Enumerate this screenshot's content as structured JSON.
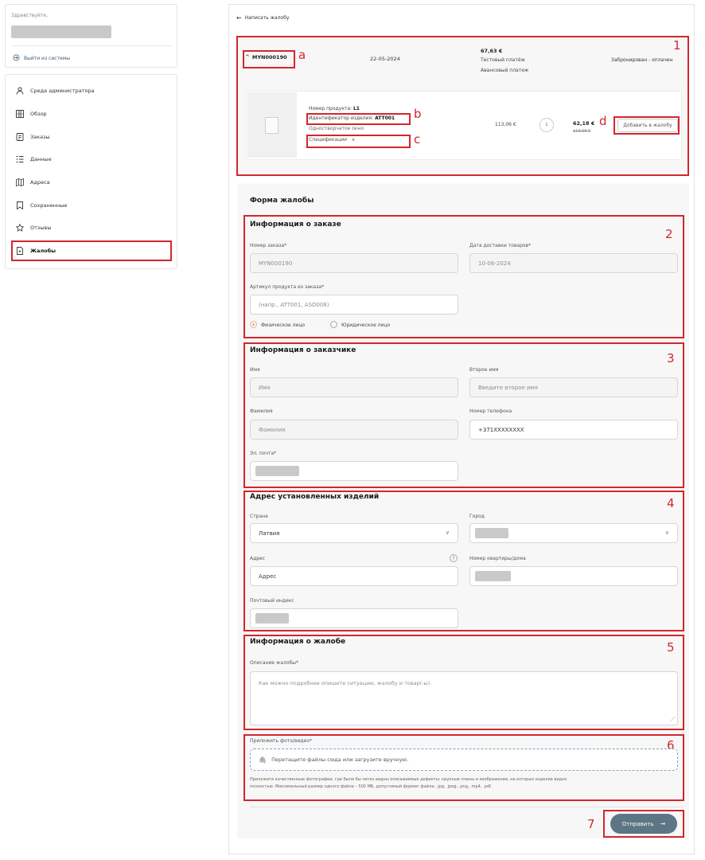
{
  "sidebar": {
    "greeting": "Здравствуйте,",
    "logout": "Выйти из системы",
    "items": [
      {
        "label": "Среда администратора",
        "icon": "user-icon"
      },
      {
        "label": "Обзор",
        "icon": "grid-icon"
      },
      {
        "label": "Заказы",
        "icon": "receipt-icon"
      },
      {
        "label": "Данные",
        "icon": "list-icon"
      },
      {
        "label": "Адреса",
        "icon": "map-icon"
      },
      {
        "label": "Сохраненные",
        "icon": "bookmark-icon"
      },
      {
        "label": "Отзывы",
        "icon": "star-icon"
      },
      {
        "label": "Жалобы",
        "icon": "document-icon",
        "active": true
      }
    ]
  },
  "header": {
    "back_label": "Написать жалобу"
  },
  "order": {
    "number": "MYN000190",
    "date": "22-05-2024",
    "total": "67,63 €",
    "payment_type": "Тестовый платёж",
    "payment_kind": "Авансовый платеж",
    "status": "Забронирован - оплачен"
  },
  "product": {
    "number_label": "Номер продукта:",
    "number_value": "L1",
    "id_label": "Идентификатор изделия:",
    "id_value": "ATT001",
    "name": "Одностворчатое окно",
    "specs_label": "Спецификации",
    "unit_price": "113,06 €",
    "quantity": "1",
    "price": "62,18 €",
    "old_price": "113,06 €",
    "add_button": "Добавить в жалобу"
  },
  "form": {
    "title": "Форма жалобы",
    "order_info": {
      "title": "Информация о заказе",
      "order_number_label": "Номер заказа*",
      "order_number_value": "MYN000190",
      "delivery_date_label": "Дата доставки товаров*",
      "delivery_date_value": "10-06-2024",
      "article_label": "Артикул продукта из заказа*",
      "article_placeholder": "(напр., ATT001, ASD008)",
      "radio_physical": "Физическое лицо",
      "radio_legal": "Юридическое лицо"
    },
    "customer": {
      "title": "Информация о заказчике",
      "name_label": "Имя",
      "name_placeholder": "Имя",
      "middle_label": "Второе имя",
      "middle_placeholder": "Введите второе имя",
      "surname_label": "Фамилия",
      "surname_placeholder": "Фамилия",
      "phone_label": "Номер телефона",
      "phone_value": "+371XXXXXXXX",
      "email_label": "Эл. почта*"
    },
    "address": {
      "title": "Адрес установленных изделий",
      "country_label": "Страна",
      "country_value": "Латвия",
      "city_label": "Город",
      "address_label": "Адрес",
      "address_placeholder": "Адрес",
      "apt_label": "Номер квартиры/дома",
      "zip_label": "Почтовый индекс"
    },
    "complaint": {
      "title": "Информация о жалобе",
      "desc_label": "Описание жалобы*",
      "desc_placeholder": "Как можно подробнее опишите ситуацию, жалобу и товар(-ы)."
    },
    "attach": {
      "label": "Приложить фото/видео*",
      "drop_text": "Перетащите файлы сюда или загрузите вручную.",
      "hint_line1": "Приложите качественные фотографии, где были бы четко видны описываемые дефекты: крупные планы и изображения, на которых изделие видно",
      "hint_line2": "полностью. Максимальный размер одного файла – 500 МБ, допустимый формат файла: .jpg, .jpeg, .png, .mp4, .pdf."
    },
    "submit": "Отправить"
  },
  "annotations": {
    "a": "a",
    "b": "b",
    "c": "c",
    "d": "d",
    "n1": "1",
    "n2": "2",
    "n3": "3",
    "n4": "4",
    "n5": "5",
    "n6": "6",
    "n7": "7"
  },
  "colors": {
    "accent_red": "#d3262d",
    "button": "#5d7685",
    "radio_on": "#f3b08a"
  }
}
